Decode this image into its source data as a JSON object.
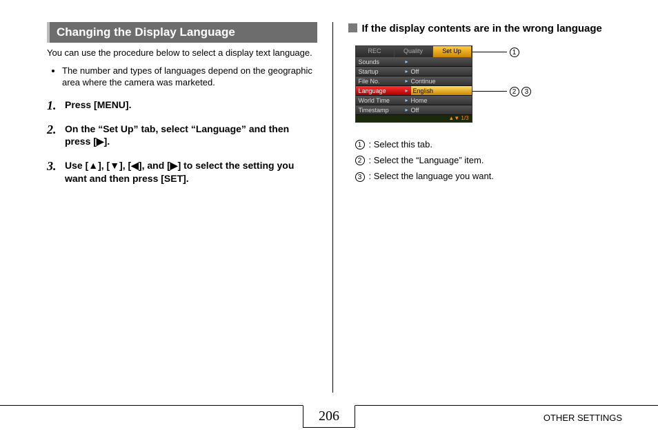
{
  "left": {
    "heading": "Changing the Display Language",
    "intro": "You can use the procedure below to select a display text language.",
    "note": "The number and types of languages depend on the geographic area where the camera was marketed.",
    "steps": [
      "Press [MENU].",
      "On the “Set Up” tab, select “Language” and then press [▶].",
      "Use [▲], [▼], [◀], and [▶] to select the setting you want and then press [SET]."
    ]
  },
  "right": {
    "subhead": "If the display contents are in the wrong language",
    "screen": {
      "tabs": [
        "REC",
        "Quality",
        "Set Up"
      ],
      "rows": [
        {
          "label": "Sounds",
          "value": ""
        },
        {
          "label": "Startup",
          "value": "Off"
        },
        {
          "label": "File No.",
          "value": "Continue"
        },
        {
          "label": "Language",
          "value": "English",
          "hl": true
        },
        {
          "label": "World Time",
          "value": "Home"
        },
        {
          "label": "Timestamp",
          "value": "Off"
        }
      ],
      "page_indicator": "1/3"
    },
    "legend": [
      ": Select this tab.",
      ": Select the “Language” item.",
      ": Select the language you want."
    ]
  },
  "footer": {
    "page": "206",
    "section": "OTHER SETTINGS"
  }
}
